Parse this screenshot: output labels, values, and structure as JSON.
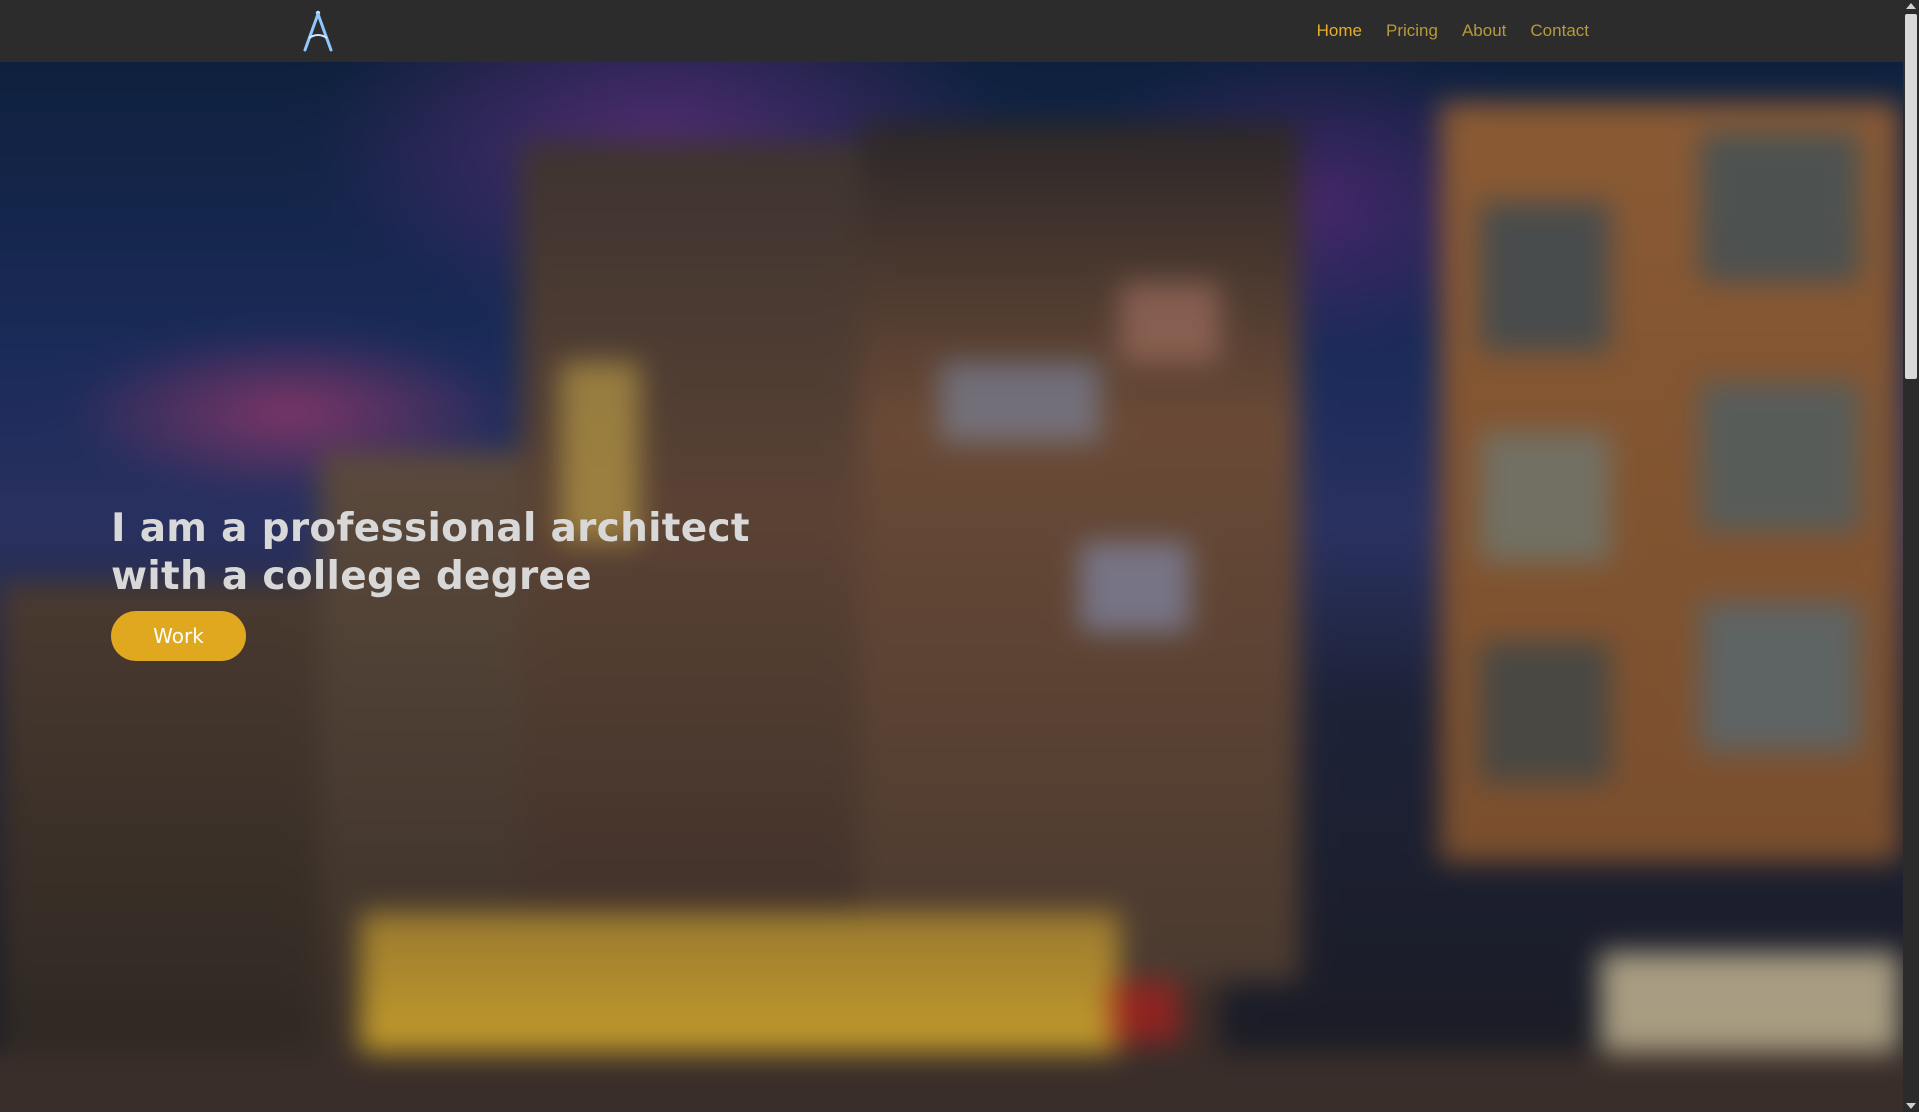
{
  "nav": {
    "logo_icon": "compass-logo-icon",
    "links": [
      {
        "label": "Home",
        "active": true
      },
      {
        "label": "Pricing",
        "active": false
      },
      {
        "label": "About",
        "active": false
      },
      {
        "label": "Contact",
        "active": false
      }
    ]
  },
  "hero": {
    "title": "I am a professional architect with a college degree",
    "button_label": "Work",
    "background_image": "blurred-building-at-dusk"
  },
  "colors": {
    "accent": "#e0a81f",
    "nav_active": "#e6ad2a",
    "nav_link": "#b79a3b",
    "navbar_bg": "#2c2c2c"
  }
}
